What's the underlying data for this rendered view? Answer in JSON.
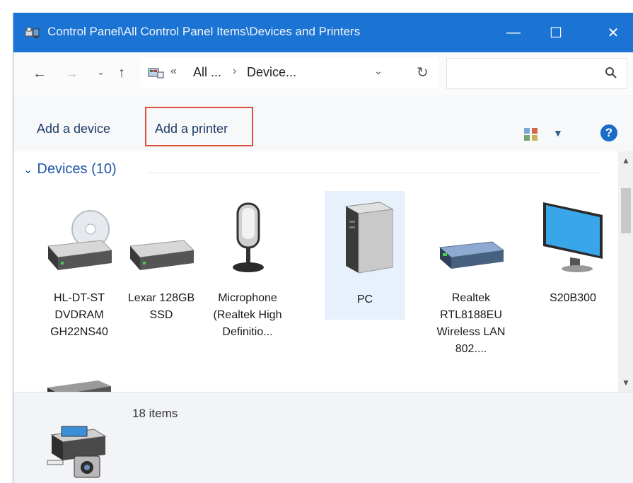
{
  "window": {
    "title": "Control Panel\\All Control Panel Items\\Devices and Printers",
    "controls": {
      "minimize": "—",
      "maximize": "☐",
      "close": "✕"
    }
  },
  "address_bar": {
    "back": "←",
    "forward": "→",
    "recent": "⌄",
    "up": "↑",
    "crumb_chevron": "«",
    "segment1": "All ...",
    "separator": "›",
    "segment2": "Device...",
    "dropdown": "⌄",
    "refresh": "↻",
    "search_placeholder": ""
  },
  "toolbar": {
    "add_device": "Add a device",
    "add_printer": "Add a printer",
    "view_dropdown": "▼",
    "help": "?"
  },
  "devices_group": {
    "chevron": "⌄",
    "title": "Devices (10)",
    "items": [
      {
        "label": "HL-DT-ST DVDRAM GH22NS40",
        "icon": "optical-drive-icon",
        "selected": false
      },
      {
        "label": "Lexar 128GB SSD",
        "icon": "drive-icon",
        "selected": false
      },
      {
        "label": "Microphone (Realtek High Definitio...",
        "icon": "microphone-icon",
        "selected": false
      },
      {
        "label": "PC",
        "icon": "computer-tower-icon",
        "selected": true
      },
      {
        "label": "Realtek RTL8188EU Wireless LAN 802....",
        "icon": "network-adapter-icon",
        "selected": false
      },
      {
        "label": "S20B300",
        "icon": "monitor-icon",
        "selected": false
      }
    ]
  },
  "scrollbar": {
    "up": "▲",
    "down": "▼"
  },
  "details": {
    "count": "18 items"
  },
  "colors": {
    "titlebar": "#1b73d3",
    "highlight": "#d94f3c",
    "link": "#1e55a8"
  }
}
